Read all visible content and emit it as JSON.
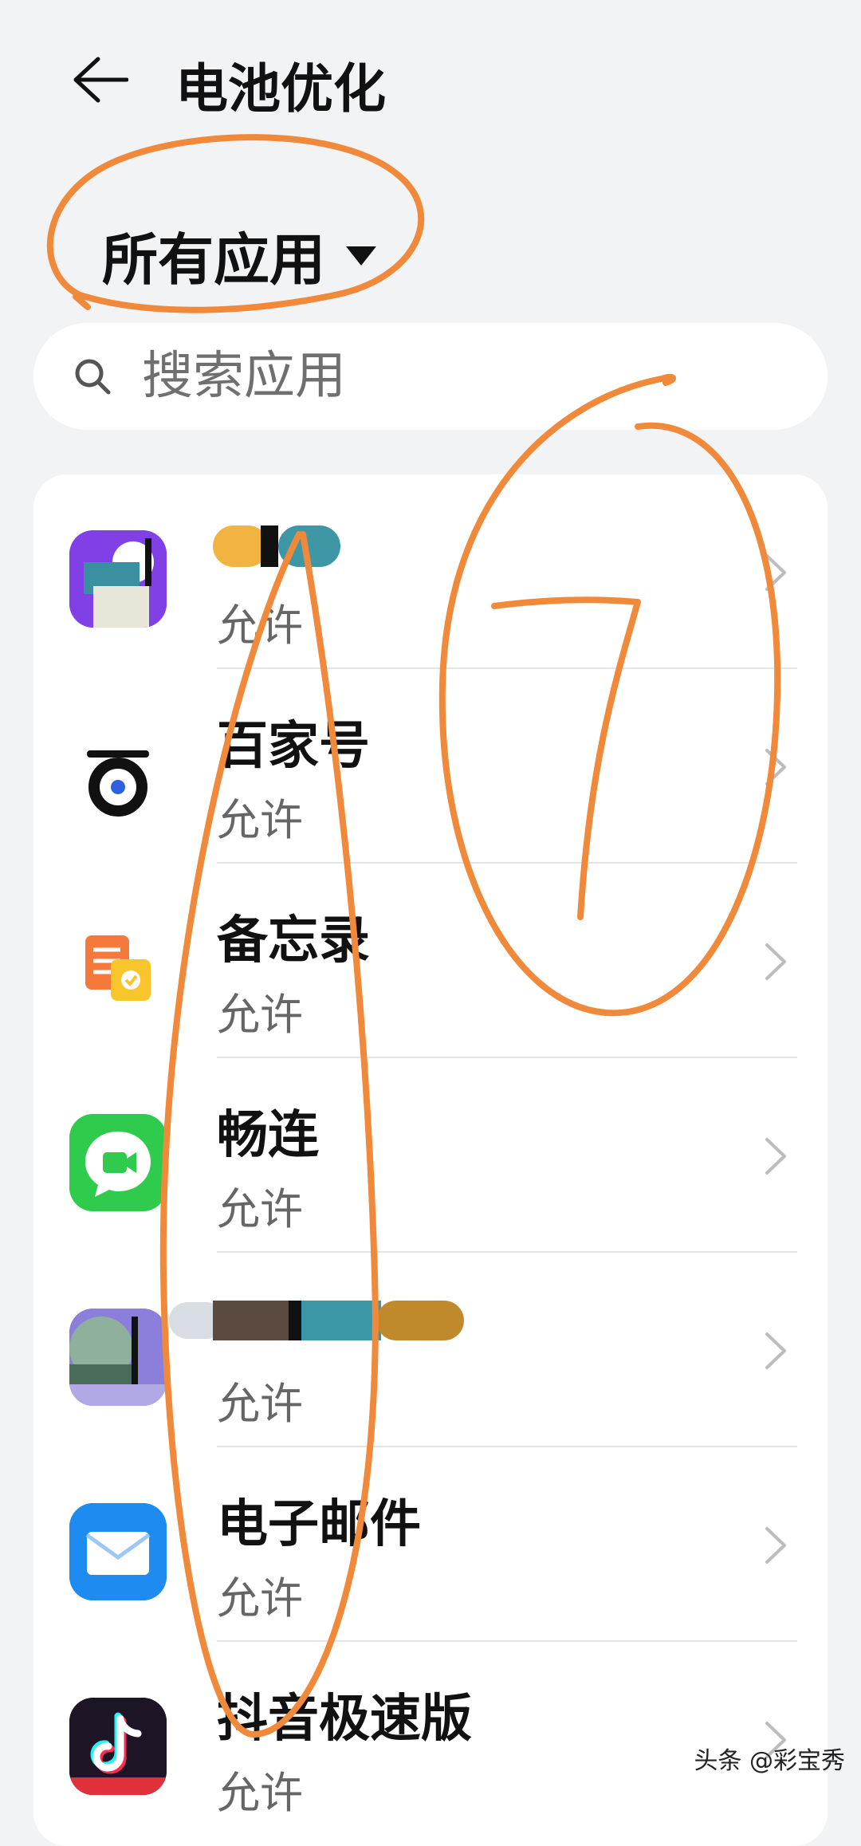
{
  "header": {
    "title": "电池优化",
    "back_icon": "arrow-left-icon"
  },
  "filter": {
    "label": "所有应用",
    "caret_icon": "caret-down-icon"
  },
  "search": {
    "placeholder": "搜索应用",
    "icon": "search-icon"
  },
  "apps": [
    {
      "name": "",
      "status": "允许",
      "icon": "app-icon-redacted",
      "icon_color": "#7b3fe4"
    },
    {
      "name": "百家号",
      "status": "允许",
      "icon": "baijiahao-icon",
      "icon_color": "#1a1a1a"
    },
    {
      "name": "备忘录",
      "status": "允许",
      "icon": "memo-icon",
      "icon_color": "#f58a3c"
    },
    {
      "name": "畅连",
      "status": "允许",
      "icon": "changlian-icon",
      "icon_color": "#2ec94a"
    },
    {
      "name": "",
      "status": "允许",
      "icon": "app-icon-redacted",
      "icon_color": "#8a7bd8"
    },
    {
      "name": "电子邮件",
      "status": "允许",
      "icon": "email-icon",
      "icon_color": "#1e8cf0"
    },
    {
      "name": "抖音极速版",
      "status": "允许",
      "icon": "douyin-icon",
      "icon_color": "#1b1b2a"
    }
  ],
  "annotation": {
    "number": "7",
    "color": "#f0893a"
  },
  "watermark": {
    "text": "头条 @彩宝秀"
  }
}
